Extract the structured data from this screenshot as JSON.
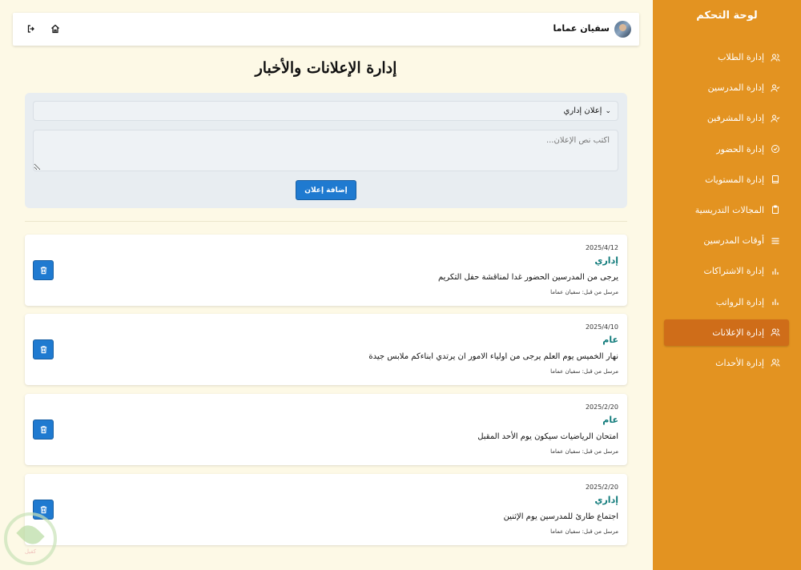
{
  "sidebar": {
    "title": "لوحة التحكم",
    "items": [
      {
        "label": "إدارة الطلاب",
        "icon": "users-icon"
      },
      {
        "label": "إدارة المدرسين",
        "icon": "user-check-icon"
      },
      {
        "label": "إدارة المشرفين",
        "icon": "user-check-icon"
      },
      {
        "label": "إدارة الحضور",
        "icon": "check-circle-icon"
      },
      {
        "label": "إدارة المستويات",
        "icon": "book-icon"
      },
      {
        "label": "المجالات التدريسية",
        "icon": "clipboard-icon"
      },
      {
        "label": "أوقات المدرسين",
        "icon": "list-icon"
      },
      {
        "label": "إدارة الاشتراكات",
        "icon": "bar-chart-icon"
      },
      {
        "label": "إدارة الرواتب",
        "icon": "bar-chart-icon"
      },
      {
        "label": "إدارة الإعلانات",
        "icon": "users-icon",
        "active": true
      },
      {
        "label": "إدارة الأحداث",
        "icon": "users-icon"
      }
    ]
  },
  "header": {
    "user_name": "سفيان عماما"
  },
  "page": {
    "title": "إدارة الإعلانات والأخبار"
  },
  "form": {
    "type_selected": "إعلان إداري",
    "text_placeholder": "اكتب نص الإعلان...",
    "add_label": "إضافة إعلان"
  },
  "announcements": [
    {
      "date": "2025/4/12",
      "type": "إداري",
      "text": "يرجى من المدرسين الحضور غدا لمناقشة حفل التكريم",
      "by": "مرسل من قبل: سفيان عماما"
    },
    {
      "date": "2025/4/10",
      "type": "عام",
      "text": "نهار الخميس يوم العلم يرجى من اولياء الامور ان يرتدي ابناءكم ملابس جيدة",
      "by": "مرسل من قبل: سفيان عماما"
    },
    {
      "date": "2025/2/20",
      "type": "عام",
      "text": "امتحان الرياضيات سيكون يوم الأحد المقبل",
      "by": "مرسل من قبل: سفيان عماما"
    },
    {
      "date": "2025/2/20",
      "type": "إداري",
      "text": "اجتماع طارئ للمدرسين يوم الإثنين",
      "by": "مرسل من قبل: سفيان عماما"
    }
  ],
  "watermark": {
    "text": "كفيل"
  },
  "colors": {
    "sidebar_bg": "#e39321",
    "sidebar_active": "#cf6d19",
    "primary_button": "#1f7ad0",
    "page_bg": "#fdf9e6",
    "type_text": "#0f7a7a"
  }
}
